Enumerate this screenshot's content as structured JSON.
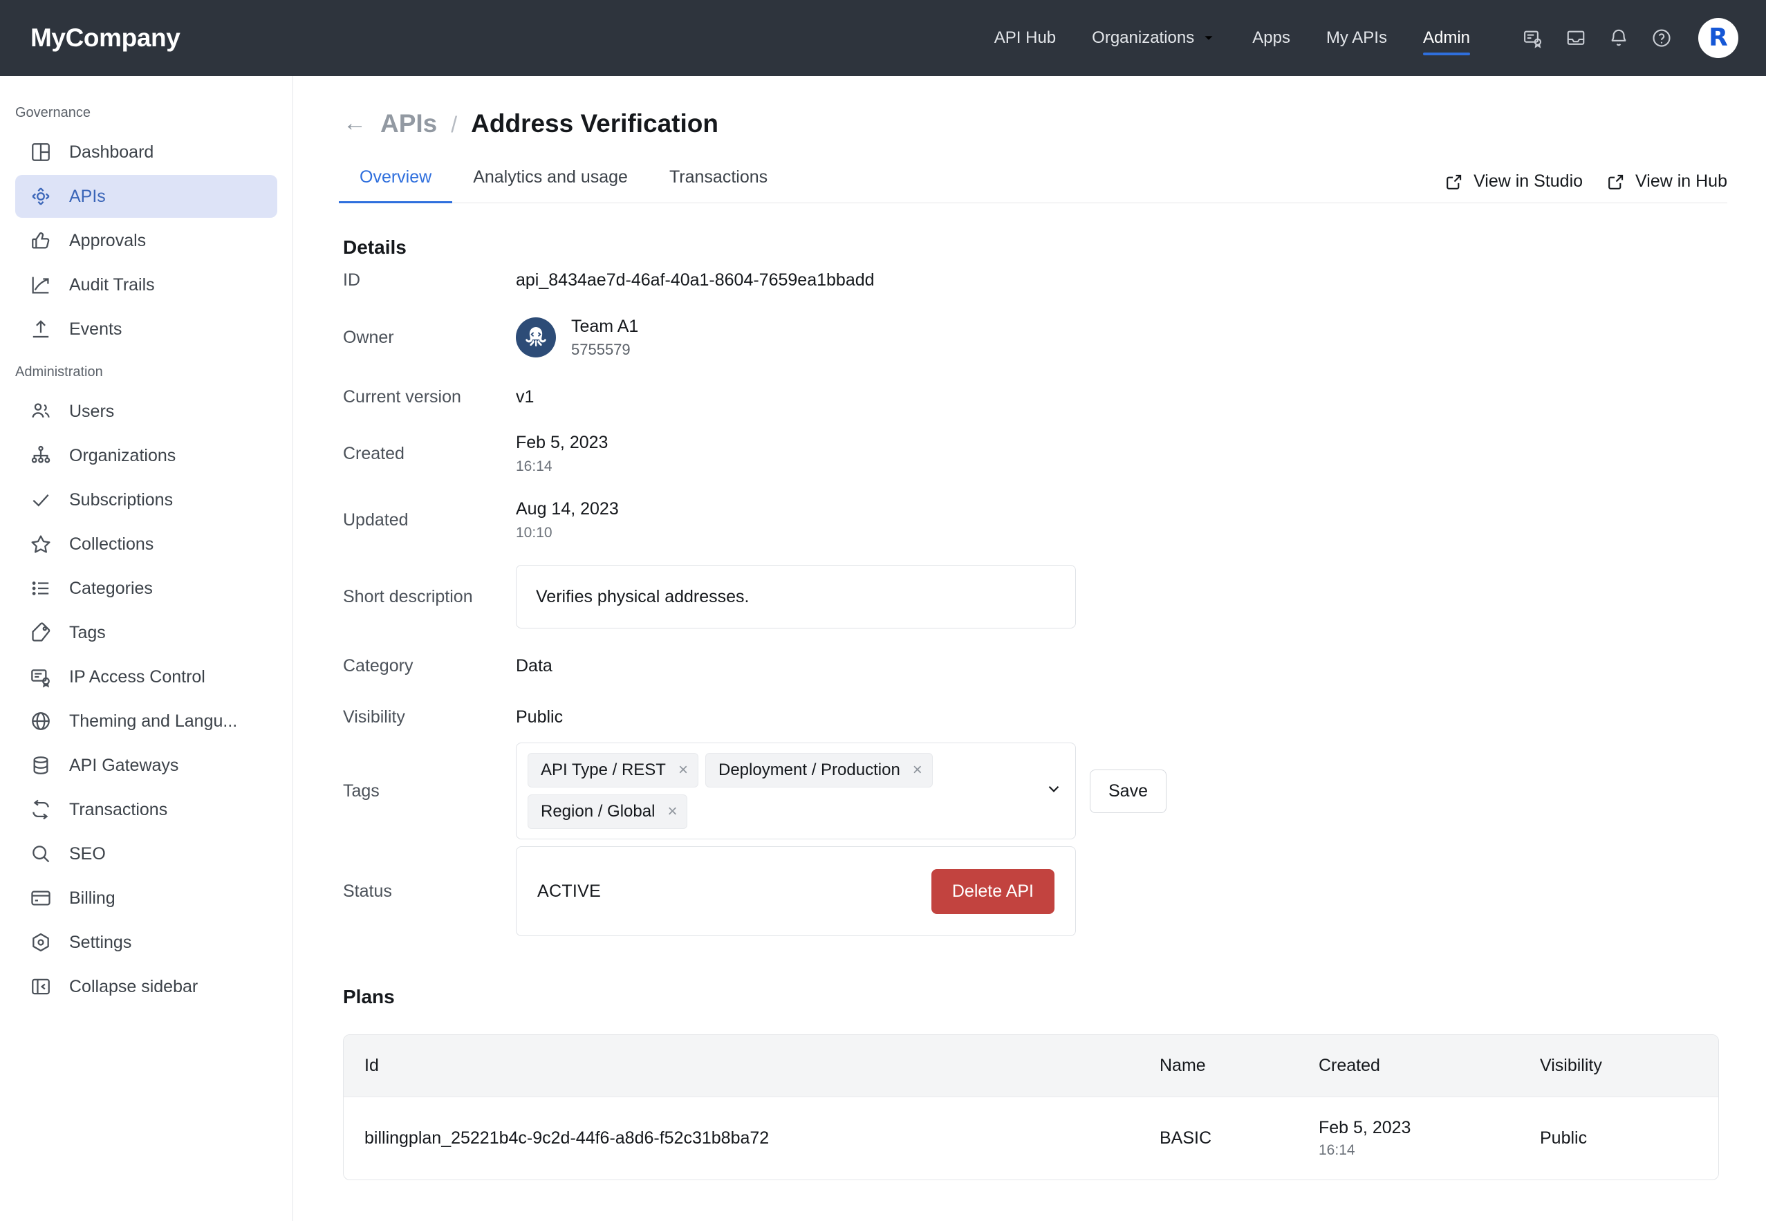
{
  "topbar": {
    "brand": "MyCompany",
    "nav": [
      {
        "label": "API Hub",
        "icon": "",
        "active": false
      },
      {
        "label": "Organizations",
        "icon": "chevron-down-icon",
        "active": false
      },
      {
        "label": "Apps",
        "icon": "",
        "active": false
      },
      {
        "label": "My APIs",
        "icon": "",
        "active": false
      },
      {
        "label": "Admin",
        "icon": "",
        "active": true
      }
    ],
    "icons": [
      "certificate-icon",
      "inbox-icon",
      "bell-icon",
      "help-circle-icon"
    ],
    "avatar_initial": "R"
  },
  "sidebar": {
    "sections": [
      {
        "title": "Governance",
        "items": [
          {
            "label": "Dashboard",
            "icon": "dashboard-icon",
            "active": false
          },
          {
            "label": "APIs",
            "icon": "apis-icon",
            "active": true
          },
          {
            "label": "Approvals",
            "icon": "thumbs-up-icon",
            "active": false
          },
          {
            "label": "Audit Trails",
            "icon": "trend-up-icon",
            "active": false
          },
          {
            "label": "Events",
            "icon": "upload-icon",
            "active": false
          }
        ]
      },
      {
        "title": "Administration",
        "items": [
          {
            "label": "Users",
            "icon": "users-icon",
            "active": false
          },
          {
            "label": "Organizations",
            "icon": "org-tree-icon",
            "active": false
          },
          {
            "label": "Subscriptions",
            "icon": "check-icon",
            "active": false
          },
          {
            "label": "Collections",
            "icon": "star-icon",
            "active": false
          },
          {
            "label": "Categories",
            "icon": "list-icon",
            "active": false
          },
          {
            "label": "Tags",
            "icon": "tag-icon",
            "active": false
          },
          {
            "label": "IP Access Control",
            "icon": "certificate-icon",
            "active": false
          },
          {
            "label": "Theming and Langu...",
            "icon": "globe-icon",
            "active": false
          },
          {
            "label": "API Gateways",
            "icon": "database-icon",
            "active": false
          },
          {
            "label": "Transactions",
            "icon": "refresh-icon",
            "active": false
          },
          {
            "label": "SEO",
            "icon": "search-icon",
            "active": false
          },
          {
            "label": "Billing",
            "icon": "card-icon",
            "active": false
          },
          {
            "label": "Settings",
            "icon": "settings-icon",
            "active": false
          },
          {
            "label": "Collapse sidebar",
            "icon": "collapse-sidebar-icon",
            "active": false
          }
        ]
      }
    ]
  },
  "page": {
    "back_arrow": "←",
    "breadcrumb_parent": "APIs",
    "breadcrumb_separator": "/",
    "title": "Address Verification",
    "tabs": [
      {
        "label": "Overview",
        "active": true
      },
      {
        "label": "Analytics and usage",
        "active": false
      },
      {
        "label": "Transactions",
        "active": false
      }
    ],
    "actions": [
      {
        "label": "View in Studio",
        "icon": "external-link-icon"
      },
      {
        "label": "View in Hub",
        "icon": "external-link-icon"
      }
    ]
  },
  "details": {
    "heading": "Details",
    "id_label": "ID",
    "id_value": "api_8434ae7d-46af-40a1-8604-7659ea1bbadd",
    "owner_label": "Owner",
    "owner_name": "Team A1",
    "owner_id": "5755579",
    "version_label": "Current version",
    "version_value": "v1",
    "created_label": "Created",
    "created_date": "Feb 5, 2023",
    "created_time": "16:14",
    "updated_label": "Updated",
    "updated_date": "Aug 14, 2023",
    "updated_time": "10:10",
    "short_description_label": "Short description",
    "short_description_value": "Verifies physical addresses.",
    "category_label": "Category",
    "category_value": "Data",
    "visibility_label": "Visibility",
    "visibility_value": "Public",
    "tags_label": "Tags",
    "tags": [
      {
        "label": "API Type / REST",
        "remove": "×"
      },
      {
        "label": "Deployment / Production",
        "remove": "×"
      },
      {
        "label": "Region / Global",
        "remove": "×"
      }
    ],
    "tags_caret": "⌄",
    "save_label": "Save",
    "status_label": "Status",
    "status_value": "ACTIVE",
    "delete_label": "Delete API"
  },
  "plans": {
    "heading": "Plans",
    "columns": [
      "Id",
      "Name",
      "Created",
      "Visibility"
    ],
    "rows": [
      {
        "id": "billingplan_25221b4c-9c2d-44f6-a8d6-f52c31b8ba72",
        "name": "BASIC",
        "created_date": "Feb 5, 2023",
        "created_time": "16:14",
        "visibility": "Public"
      }
    ]
  },
  "colors": {
    "topbar_bg": "#2e343d",
    "accent_blue": "#2f6fdd",
    "sidebar_active_bg": "#dde3f7",
    "sidebar_active_fg": "#3a65b8",
    "danger_red": "#c2433f",
    "avatar_navy": "#2d4c77"
  }
}
